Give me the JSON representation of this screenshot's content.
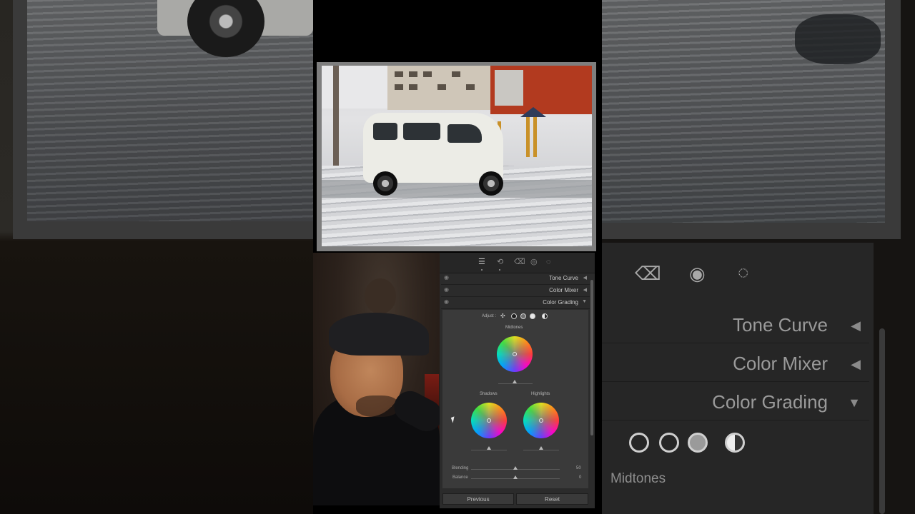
{
  "panel": {
    "toolbar_icons": [
      "sliders-icon",
      "crop-icon",
      "eraser-icon",
      "redeye-icon",
      "mask-icon"
    ],
    "sections": [
      {
        "label": "Tone Curve"
      },
      {
        "label": "Color Mixer"
      },
      {
        "label": "Color Grading"
      }
    ],
    "color_grading": {
      "adjust_label": "Adjust :",
      "midtones_label": "Midtones",
      "shadows_label": "Shadows",
      "highlights_label": "Highlights",
      "blending_label": "Blending",
      "blending_value": "50",
      "balance_label": "Balance",
      "balance_value": "0"
    },
    "buttons": {
      "previous": "Previous",
      "reset": "Reset"
    }
  },
  "background_panel": {
    "sections": [
      {
        "label": "Tone Curve"
      },
      {
        "label": "Color Mixer"
      },
      {
        "label": "Color Grading"
      }
    ],
    "midtones_label": "Midtones"
  },
  "colors": {
    "panel_bg": "#2b2b2b",
    "section_bg": "#3a3a3a",
    "text": "#c9c9c9"
  }
}
